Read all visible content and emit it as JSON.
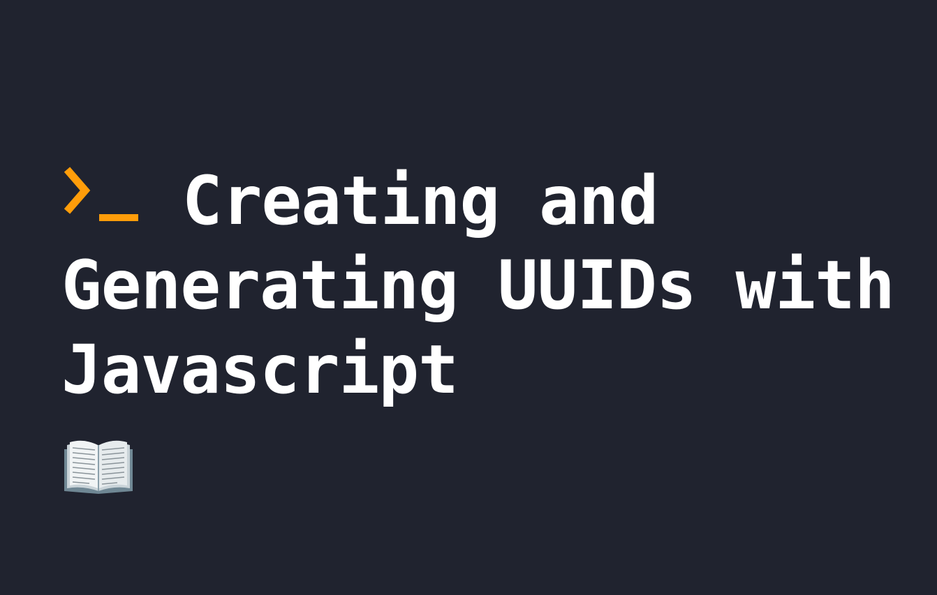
{
  "title": "Creating and Generating UUIDs with Javascript",
  "prompt_icon": "terminal-prompt-icon",
  "book_icon": "open-book-icon",
  "colors": {
    "background": "#20232f",
    "text": "#ffffff",
    "accent": "#ff9d0a"
  }
}
